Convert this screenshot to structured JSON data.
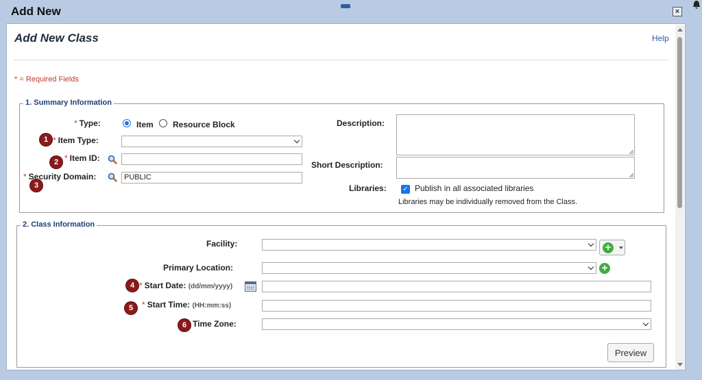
{
  "window": {
    "title": "Add New",
    "close_glyph": "×"
  },
  "page": {
    "title": "Add New Class",
    "help": "Help",
    "required_note": "* = Required Fields"
  },
  "summary": {
    "legend": "1. Summary Information",
    "type_label": "Type:",
    "type_options": [
      "Item",
      "Resource Block"
    ],
    "type_selected": "Item",
    "item_type_label": "Item Type:",
    "item_type_value": "",
    "item_id_label": "Item ID:",
    "item_id_value": "",
    "security_domain_label": "Security Domain:",
    "security_domain_value": "PUBLIC",
    "description_label": "Description:",
    "short_description_label": "Short Description:",
    "libraries_label": "Libraries:",
    "publish_label": "Publish in all associated libraries",
    "publish_checked": true,
    "libraries_note": "Libraries may be individually removed from the Class."
  },
  "class_info": {
    "legend": "2. Class Information",
    "facility_label": "Facility:",
    "primary_location_label": "Primary Location:",
    "start_date_label": "Start Date:",
    "start_date_hint": "(dd/mm/yyyy)",
    "start_time_label": "Start Time:",
    "start_time_hint": "(HH:mm:ss)",
    "time_zone_label": "Time Zone:"
  },
  "badges": [
    "1",
    "2",
    "3",
    "4",
    "5",
    "6"
  ],
  "actions": {
    "preview": "Preview"
  },
  "colors": {
    "accent": "#1a73e8",
    "required": "#c0392b",
    "badge": "#8b1a1a",
    "add": "#3fae3f"
  }
}
